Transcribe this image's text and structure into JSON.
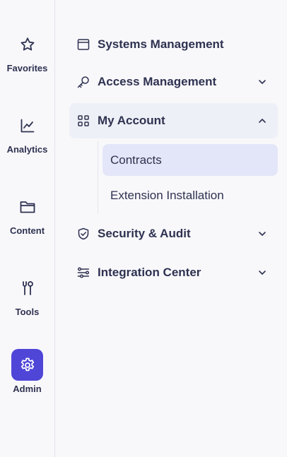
{
  "rail": {
    "items": [
      {
        "label": "Favorites",
        "icon": "star-icon"
      },
      {
        "label": "Analytics",
        "icon": "chart-icon"
      },
      {
        "label": "Content",
        "icon": "folder-icon"
      },
      {
        "label": "Tools",
        "icon": "tools-icon"
      },
      {
        "label": "Admin",
        "icon": "gear-icon",
        "active": true
      }
    ]
  },
  "nav": {
    "items": [
      {
        "label": "Systems Management",
        "icon": "window-icon"
      },
      {
        "label": "Access Management",
        "icon": "key-icon",
        "expandable": true
      },
      {
        "label": "My Account",
        "icon": "grid-icon",
        "expandable": true,
        "expanded": true
      },
      {
        "label": "Security & Audit",
        "icon": "shield-check-icon",
        "expandable": true
      },
      {
        "label": "Integration Center",
        "icon": "sliders-icon",
        "expandable": true
      }
    ],
    "my_account_sub": [
      {
        "label": "Contracts",
        "selected": true
      },
      {
        "label": "Extension Installation"
      }
    ]
  },
  "colors": {
    "accent": "#4f46d8",
    "text": "#2e3250",
    "selected_bg": "#e3e6f8",
    "open_bg": "#eef0f7"
  }
}
